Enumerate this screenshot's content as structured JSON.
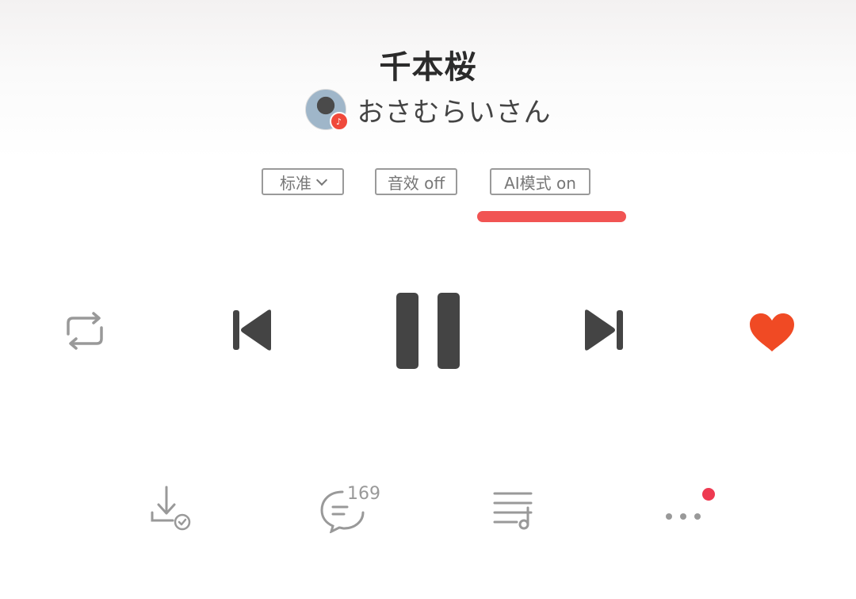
{
  "song": {
    "title": "千本桜",
    "artist": "おさむらいさん"
  },
  "chips": {
    "quality": "标准",
    "effect": "音效 off",
    "ai_mode": "AI模式 on"
  },
  "comments": {
    "count": "169"
  },
  "colors": {
    "accent": "#f15453",
    "like": "#f04a24",
    "notification_dot": "#ee3a51",
    "icon": "#444444"
  },
  "icons": {
    "repeat": "repeat-icon",
    "previous": "skip-previous-icon",
    "pause": "pause-icon",
    "next": "skip-next-icon",
    "like": "heart-icon",
    "download": "download-icon",
    "comment": "comment-icon",
    "playlist": "playlist-icon",
    "more": "more-icon"
  }
}
